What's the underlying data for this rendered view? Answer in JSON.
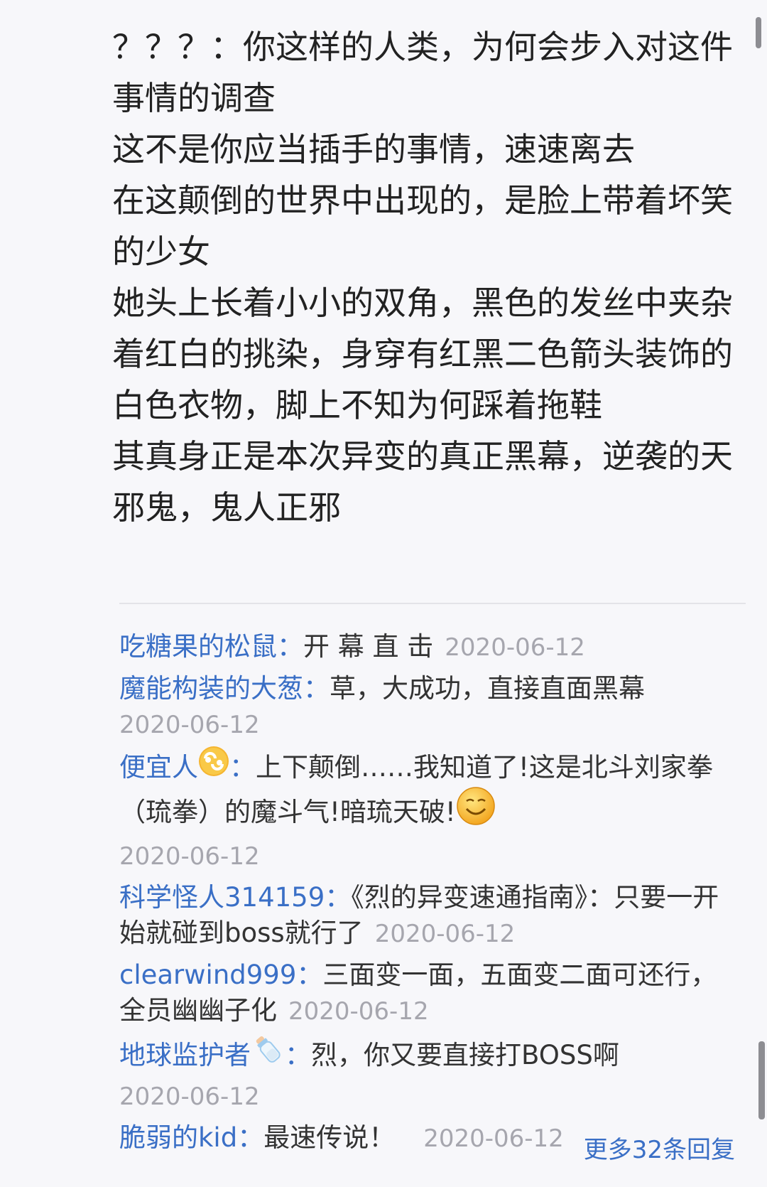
{
  "post": {
    "lines": [
      "？？？：你这样的人类，为何会步入对这件事情的调查",
      " 这不是你应当插手的事情，速速离去",
      "在这颠倒的世界中出现的，是脸上带着坏笑的少女",
      "她头上长着小小的双角，黑色的发丝中夹杂着红白的挑染，身穿有红黑二色箭头装饰的白色衣物，脚上不知为何踩着拖鞋",
      "其真身正是本次异变的真正黑幕，逆袭的天邪鬼，鬼人正邪"
    ]
  },
  "replies": [
    {
      "user": "吃糖果的松鼠",
      "text": "开 幕 直 击",
      "date": "2020-06-12"
    },
    {
      "user": "魔能构装的大葱",
      "text": "草，大成功，直接直面黑幕",
      "date": "2020-06-12"
    },
    {
      "user": "便宜人",
      "badge": "cancer-zodiac-icon",
      "text_1": "上下颠倒……我知道了!这是北斗刘家拳（琉拳）的魔斗气!暗琉天破!",
      "emoji": "smile-emoji",
      "date": "2020-06-12"
    },
    {
      "user": "科学怪人314159",
      "text": "《烈的异变速通指南》：只要一开始就碰到boss就行了",
      "date": "2020-06-12"
    },
    {
      "user": "clearwind999",
      "text": "三面变一面，五面变二面可还行，全员幽幽子化",
      "date": "2020-06-12"
    },
    {
      "user": "地球监护者",
      "badge": "baby-bottle-icon",
      "text": "烈，你又要直接打BOSS啊",
      "date": "2020-06-12"
    },
    {
      "user": "脆弱的kid",
      "text": "最速传说！",
      "date": "2020-06-12"
    }
  ],
  "more_replies": "更多32条回复",
  "colon": "：",
  "colors": {
    "link": "#3a6fc6",
    "date": "#a6a6ae",
    "text": "#333333",
    "background": "#f7f7fa"
  }
}
